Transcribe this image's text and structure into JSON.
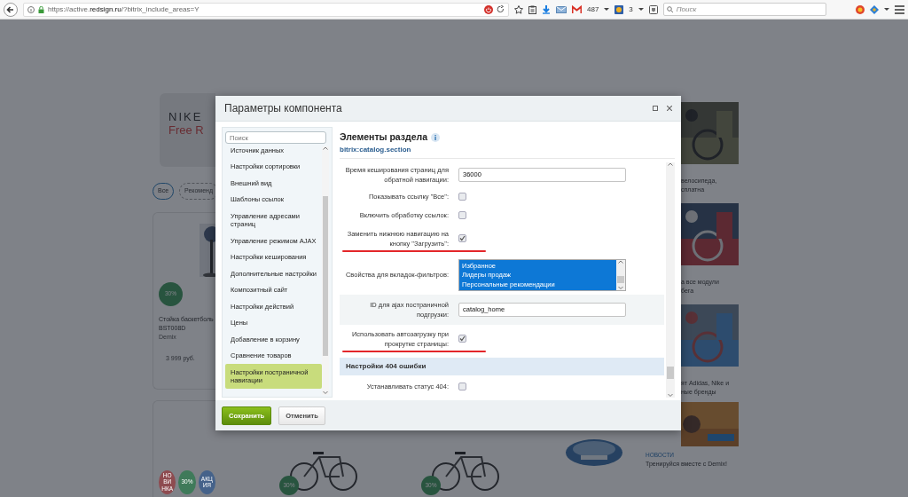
{
  "browser": {
    "url": "https://active.**redsign.ru**/?bitrix_include_areas=Y",
    "mail_count": "487",
    "badge_count": "3",
    "search": {
      "placeholder": "Поиск"
    }
  },
  "page": {
    "banner": {
      "line1": "NIKE",
      "line2": "Free R"
    },
    "tags": [
      {
        "label": "Все",
        "selected": true
      },
      {
        "label": "Рекоменд",
        "selected": false
      }
    ],
    "product": {
      "discount": "30%",
      "name": "Стойка баскетболь",
      "code": "BST008D",
      "brand": "Demix",
      "price": "3 999 руб."
    },
    "bottom_badges": [
      {
        "lines": [
          "НО",
          "ВИ",
          "НКА"
        ],
        "color": "#8e4b50"
      },
      {
        "lines": [
          "30%"
        ],
        "color": "#3f7a5a"
      },
      {
        "lines": [
          "АКЦ",
          "ИЯ"
        ],
        "color": "#45628a"
      }
    ],
    "bottom_products": [
      {
        "discount": "30%"
      },
      {
        "discount": "30%"
      }
    ],
    "news": [
      {
        "lines": [
          "велосипеда,",
          "сплатна"
        ]
      },
      {
        "lines": [
          "а все модули",
          "бега"
        ]
      },
      {
        "lines": [
          "ят Adidas, Nike и",
          "ные бренды"
        ]
      }
    ],
    "news_heading": "НОВОСТИ",
    "news_item": "Тренируйся вместе с Demix!"
  },
  "modal": {
    "title": "Параметры компонента",
    "search": {
      "placeholder": "Поиск"
    },
    "sections": [
      {
        "label": "Источник данных",
        "selected": false
      },
      {
        "label": "Настройки сортировки",
        "selected": false
      },
      {
        "label": "Внешний вид",
        "selected": false
      },
      {
        "label": "Шаблоны ссылок",
        "selected": false
      },
      {
        "label": "Управление адресами страниц",
        "selected": false
      },
      {
        "label": "Управление режимом AJAX",
        "selected": false
      },
      {
        "label": "Настройки кеширования",
        "selected": false
      },
      {
        "label": "Дополнительные настройки",
        "selected": false
      },
      {
        "label": "Композитный сайт",
        "selected": false
      },
      {
        "label": "Настройки действий",
        "selected": false
      },
      {
        "label": "Цены",
        "selected": false
      },
      {
        "label": "Добавление в корзину",
        "selected": false
      },
      {
        "label": "Сравнение товаров",
        "selected": false
      },
      {
        "label": "Настройки постраничной навигации",
        "selected": true
      }
    ],
    "heading": "Элементы раздела",
    "component": "bitrix:catalog.section",
    "rows": [
      {
        "kind": "input",
        "label": "Время кеширования страниц для обратной навигации:",
        "value": "36000",
        "shaded": false
      },
      {
        "kind": "checkbox",
        "label": "Показывать ссылку \"Все\":",
        "checked": false,
        "underlined": false
      },
      {
        "kind": "checkbox",
        "label": "Включить обработку ссылок:",
        "checked": false,
        "underlined": false
      },
      {
        "kind": "checkbox",
        "label": "Заменить нижнюю навигацию на кнопку \"Загрузить\":",
        "checked": true,
        "underlined": true
      },
      {
        "kind": "multiselect",
        "label": "Свойства для вкладок-фильтров:",
        "options": [
          {
            "label": "Избранное",
            "selected": true
          },
          {
            "label": "Лидеры продаж",
            "selected": true
          },
          {
            "label": "Персональные рекомендации",
            "selected": true
          }
        ]
      },
      {
        "kind": "input",
        "label": "ID для ajax постраничной подгрузки:",
        "value": "catalog_home",
        "shaded": true
      },
      {
        "kind": "checkbox",
        "label": "Использовать автозагрузку при прокрутке страницы:",
        "checked": true,
        "underlined": true
      },
      {
        "kind": "section",
        "label": "Настройки 404 ошибки"
      },
      {
        "kind": "checkbox",
        "label": "Устанавливать статус 404:",
        "checked": false,
        "underlined": false
      }
    ],
    "buttons": [
      {
        "label": "Сохранить",
        "kind": "primary"
      },
      {
        "label": "Отменить",
        "kind": "secondary"
      }
    ]
  }
}
